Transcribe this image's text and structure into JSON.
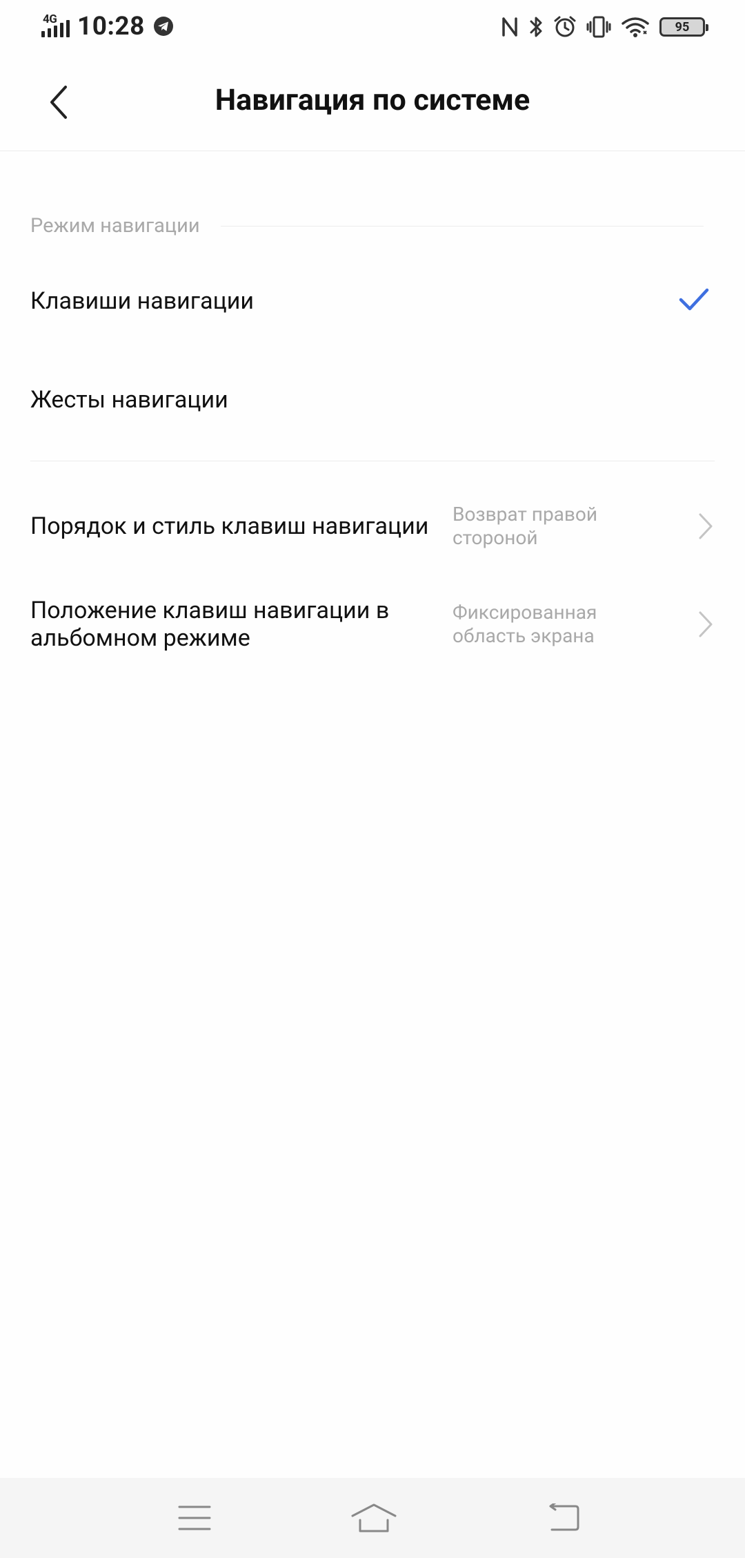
{
  "status_bar": {
    "network": "4G",
    "time": "10:28",
    "battery": "95",
    "icons": [
      "signal-icon",
      "telegram-icon",
      "nfc-icon",
      "bluetooth-icon",
      "alarm-icon",
      "vibrate-icon",
      "wifi-icon",
      "battery-icon"
    ]
  },
  "header": {
    "title": "Навигация по системе",
    "back_icon": "chevron-left-icon"
  },
  "section": {
    "title": "Режим навигации",
    "options": [
      {
        "label": "Клавиши навигации",
        "selected": true
      },
      {
        "label": "Жесты навигации",
        "selected": false
      }
    ]
  },
  "settings": [
    {
      "title": "Порядок и стиль клавиш навигации",
      "value": "Возврат правой стороной"
    },
    {
      "title": "Положение клавиш навигации в альбомном режиме",
      "value": "Фиксированная область экрана"
    }
  ],
  "colors": {
    "accent": "#3e6fe0",
    "secondary_text": "#a9a9a9",
    "divider": "#ececec",
    "navbar_bg": "#f5f5f5"
  },
  "system_nav": [
    "menu-icon",
    "home-icon",
    "back-icon"
  ]
}
